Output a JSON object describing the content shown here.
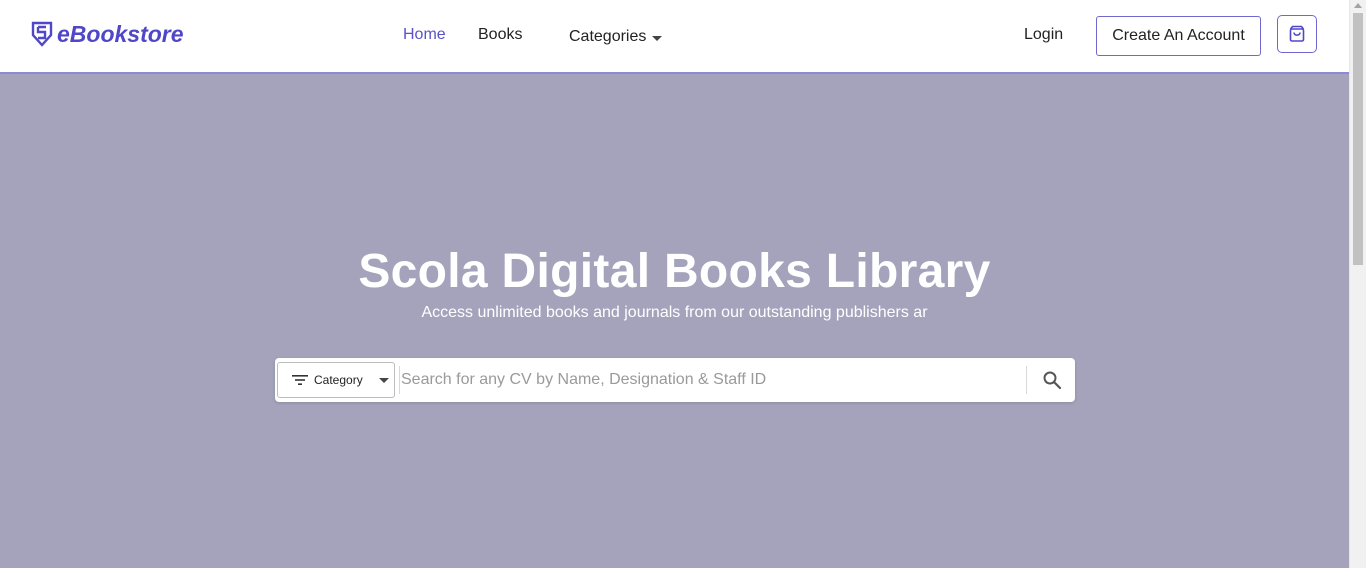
{
  "navbar": {
    "brand": "eBookstore",
    "links": {
      "home": "Home",
      "books": "Books",
      "categories": "Categories"
    },
    "login": "Login",
    "create_account": "Create An Account"
  },
  "hero": {
    "title": "Scola Digital Books Library",
    "subtitle": "Access unlimited books and journals from our outstanding publishers ar"
  },
  "search": {
    "category_label": "Category",
    "placeholder": "Search for any CV by Name, Designation & Staff ID"
  },
  "colors": {
    "brand": "#5046c8",
    "active_link": "#5a52c9",
    "hero_bg": "#a4a3bb",
    "button_border": "#6f69cf"
  },
  "icons": {
    "logo": "shield-logo-icon",
    "categories_caret": "chevron-down-icon",
    "cart": "shopping-bag-icon",
    "filter": "filter-icon",
    "category_caret": "chevron-down-icon",
    "search": "search-icon"
  }
}
